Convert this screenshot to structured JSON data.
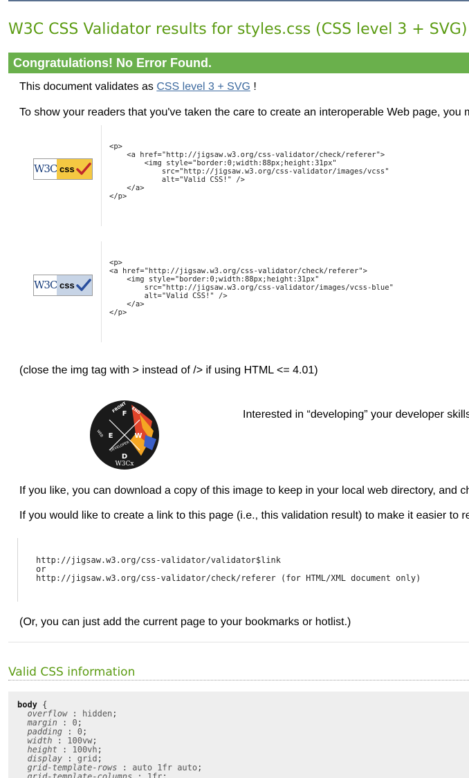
{
  "title": "W3C CSS Validator results for styles.css (CSS level 3 + SVG)",
  "result_banner": "Congratulations! No Error Found.",
  "validates_as": {
    "prefix": "This document validates as",
    "profile_link": "CSS level 3 + SVG",
    "suffix": "!"
  },
  "readers_text": "To show your readers that you've taken the care to create an interoperable Web page, you m",
  "badges": [
    {
      "w3c": "W3C",
      "css": "css",
      "variant": "gold",
      "check_color": "#c0282b",
      "code": "<p>\n    <a href=\"http://jigsaw.w3.org/css-validator/check/referer\">\n        <img style=\"border:0;width:88px;height:31px\"\n            src=\"http://jigsaw.w3.org/css-validator/images/vcss\"\n            alt=\"Valid CSS!\" />\n    </a>\n</p>"
    },
    {
      "w3c": "W3C",
      "css": "css",
      "variant": "blue",
      "check_color": "#2a4f9e",
      "code": "<p>\n<a href=\"http://jigsaw.w3.org/css-validator/check/referer\">\n    <img style=\"border:0;width:88px;height:31px\"\n        src=\"http://jigsaw.w3.org/css-validator/images/vcss-blue\"\n        alt=\"Valid CSS!\" />\n    </a>\n</p>"
    }
  ],
  "close_tag_note": "(close the img tag with > instead of /> if using HTML <= 4.01)",
  "logo": {
    "letters": [
      "FRONT",
      "END",
      "WEB",
      "DEVELOPER",
      "F",
      "E",
      "W",
      "D",
      "W3Cx"
    ],
    "colors": {
      "background": "#1a1a1a",
      "accent_orange": "#f5a623",
      "accent_red": "#e0442b",
      "accent_blue": "#3a5fc8"
    }
  },
  "promo_text": "Interested in “developing” your developer skills",
  "download_text": "If you like, you can download a copy of this image to keep in your local web directory, and ch",
  "link_text": "If you would like to create a link to this page (i.e., this validation result) to make it easier to re",
  "link_code": "http://jigsaw.w3.org/css-validator/validator$link\nor\nhttp://jigsaw.w3.org/css-validator/check/referer (for HTML/XML document only)",
  "bookmark_text": "(Or, you can just add the current page to your bookmarks or hotlist.)",
  "section_title": "Valid CSS information",
  "css_rules": {
    "selector": "body",
    "open": "{",
    "declarations": [
      {
        "prop": "overflow",
        "value": "hidden"
      },
      {
        "prop": "margin",
        "value": "0"
      },
      {
        "prop": "padding",
        "value": "0"
      },
      {
        "prop": "width",
        "value": "100vw"
      },
      {
        "prop": "height",
        "value": "100vh"
      },
      {
        "prop": "display",
        "value": "grid"
      },
      {
        "prop": "grid-template-rows",
        "value": "auto 1fr auto"
      },
      {
        "prop": "grid-template-columns",
        "value": "1fr"
      }
    ]
  },
  "colors": {
    "title_green": "#5b9b12",
    "banner_green": "#6ab04c",
    "link_blue": "#3d6a9f"
  }
}
